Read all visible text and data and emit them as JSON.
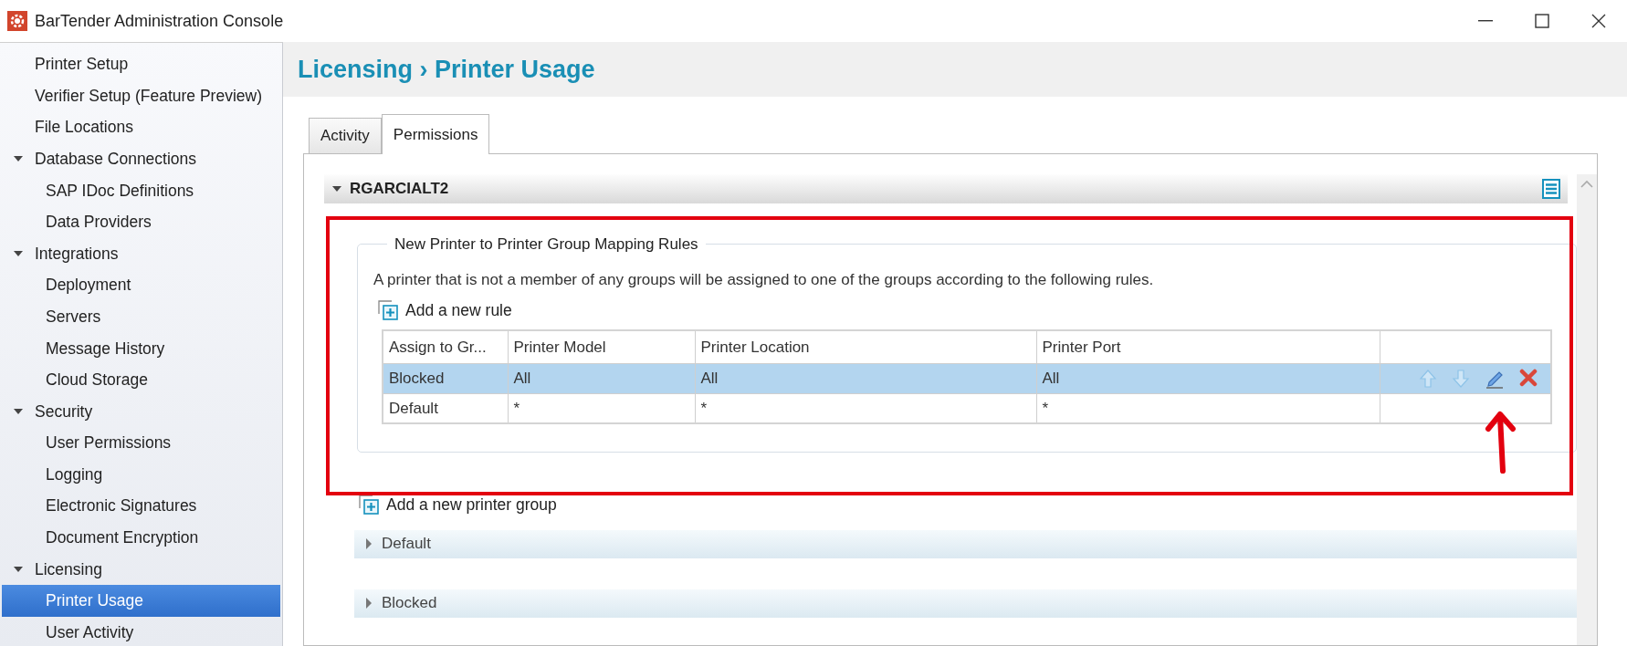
{
  "window": {
    "title": "BarTender Administration Console"
  },
  "sidebar": {
    "items": [
      {
        "label": "Printer Setup",
        "selected": false
      },
      {
        "label": "Verifier Setup (Feature Preview)",
        "selected": false
      },
      {
        "label": "File Locations",
        "selected": false
      },
      {
        "label": "Database Connections",
        "selected": false,
        "expanded": true,
        "children": [
          {
            "label": "SAP IDoc Definitions",
            "selected": false
          },
          {
            "label": "Data Providers",
            "selected": false
          }
        ]
      },
      {
        "label": "Integrations",
        "selected": false,
        "expanded": true,
        "children": [
          {
            "label": "Deployment",
            "selected": false
          },
          {
            "label": "Servers",
            "selected": false
          },
          {
            "label": "Message History",
            "selected": false
          },
          {
            "label": "Cloud Storage",
            "selected": false
          }
        ]
      },
      {
        "label": "Security",
        "selected": false,
        "expanded": true,
        "children": [
          {
            "label": "User Permissions",
            "selected": false
          },
          {
            "label": "Logging",
            "selected": false
          },
          {
            "label": "Electronic Signatures",
            "selected": false
          },
          {
            "label": "Document Encryption",
            "selected": false
          }
        ]
      },
      {
        "label": "Licensing",
        "selected": false,
        "expanded": true,
        "children": [
          {
            "label": "Printer Usage",
            "selected": true
          },
          {
            "label": "User Activity",
            "selected": false
          }
        ]
      }
    ]
  },
  "page_title": "Licensing › Printer Usage",
  "tabs": [
    {
      "label": "Activity",
      "selected": false
    },
    {
      "label": "Permissions",
      "selected": true
    }
  ],
  "computer_group": {
    "title": "RGARCIALT2",
    "expanded": true,
    "rules": {
      "legend": "New Printer to Printer Group Mapping Rules",
      "description": "A printer that is not a member of any groups will be assigned to one of the groups according to the following rules.",
      "add_rule": "Add a new rule",
      "table": {
        "columns": [
          "Assign to Gr...",
          "Printer Model",
          "Printer Location",
          "Printer Port"
        ],
        "rows": [
          {
            "cells": [
              "Blocked",
              "All",
              "All",
              "All"
            ],
            "selected": true
          },
          {
            "cells": [
              "Default",
              "*",
              "*",
              "*"
            ],
            "selected": false
          }
        ]
      }
    },
    "add_group": "Add a new printer group",
    "printer_groups": [
      {
        "name": "Default",
        "expanded": false
      },
      {
        "name": "Blocked",
        "expanded": false
      }
    ]
  }
}
